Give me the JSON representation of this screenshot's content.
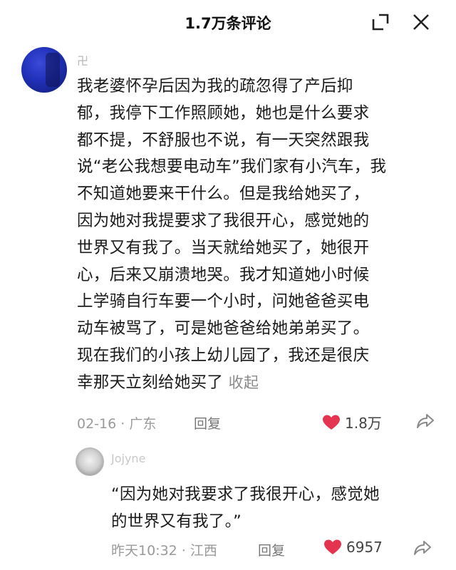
{
  "header": {
    "title": "1.7万条评论",
    "expand_icon": "expand-corner-icon",
    "close_icon": "close-icon"
  },
  "main_comment": {
    "username": "卍",
    "text": "我老婆怀孕后因为我的疏忽得了产后抑\n郁，我停下工作照顾她，她也是什么要求\n都不提，不舒服也不说，有一天突然跟我\n说“老公我想要电动车”我们家有小汽车，我\n不知道她要来干什么。但是我给她买了，\n因为她对我提要求了我很开心，感觉她的\n世界又有我了。当天就给她买了，她很开\n心，后来又崩溃地哭。我才知道她小时候\n上学骑自行车要一个小时，问她爸爸买电\n动车被骂了，可是她爸爸给她弟弟买了。\n现在我们的小孩上幼儿园了，我还是很庆\n幸那天立刻给她买了",
    "collapse_label": "收起",
    "date": "02-16 · 广东",
    "reply_label": "回复",
    "like_count": "1.8万",
    "heart_color": "#e5344f"
  },
  "reply_comment": {
    "username": "Jojyne",
    "text": "“因为她对我要求了我很开心，感觉她\n的世界又有我了。”",
    "date": "昨天10:32 · 江西",
    "reply_label": "回复",
    "like_count": "6957",
    "heart_color": "#e5344f"
  }
}
